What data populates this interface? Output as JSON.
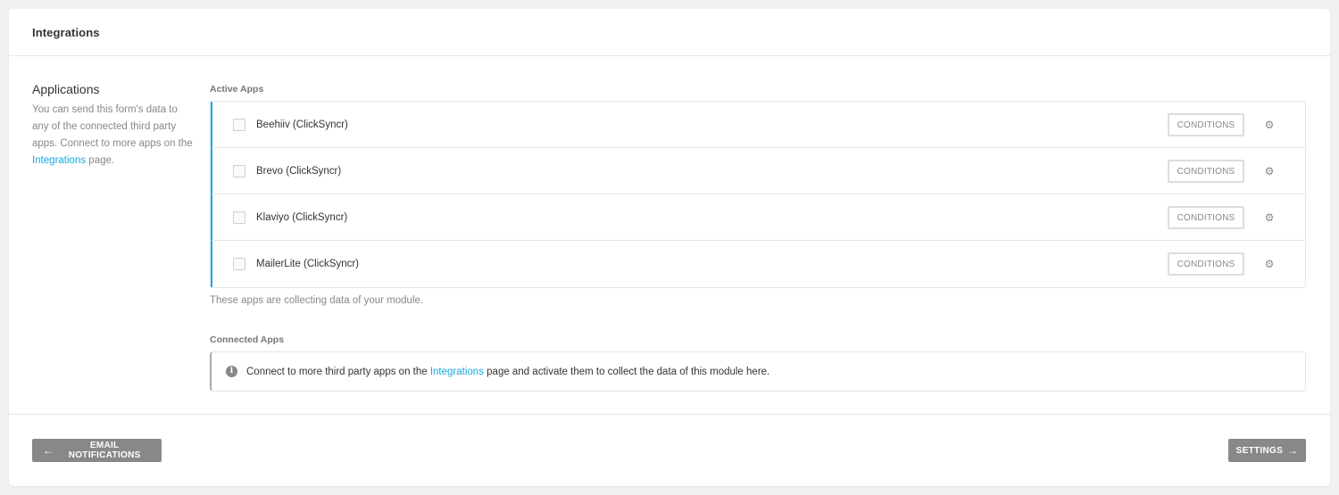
{
  "header": {
    "title": "Integrations"
  },
  "sidebar": {
    "title": "Applications",
    "desc_before": "You can send this form's data to any of the connected third party apps. Connect to more apps on the ",
    "link": "Integrations",
    "desc_after": " page."
  },
  "active_apps": {
    "label": "Active Apps",
    "items": [
      {
        "name": "Beehiiv (ClickSyncr)",
        "button": "CONDITIONS",
        "icon": "gear-icon"
      },
      {
        "name": "Brevo (ClickSyncr)",
        "button": "CONDITIONS",
        "icon": "gear-icon"
      },
      {
        "name": "Klaviyo (ClickSyncr)",
        "button": "CONDITIONS",
        "icon": "gear-icon"
      },
      {
        "name": "MailerLite (ClickSyncr)",
        "button": "CONDITIONS",
        "icon": "gear-icon"
      }
    ],
    "note": "These apps are collecting data of your module."
  },
  "connected_apps": {
    "label": "Connected Apps",
    "text_before": "Connect to more third party apps on the ",
    "link": "Integrations",
    "text_after": " page and activate them to collect the data of this module here."
  },
  "footer": {
    "prev_label": "EMAIL NOTIFICATIONS",
    "next_label": "SETTINGS"
  },
  "colors": {
    "accent": "#17a8e3",
    "button_gray": "#888888"
  }
}
